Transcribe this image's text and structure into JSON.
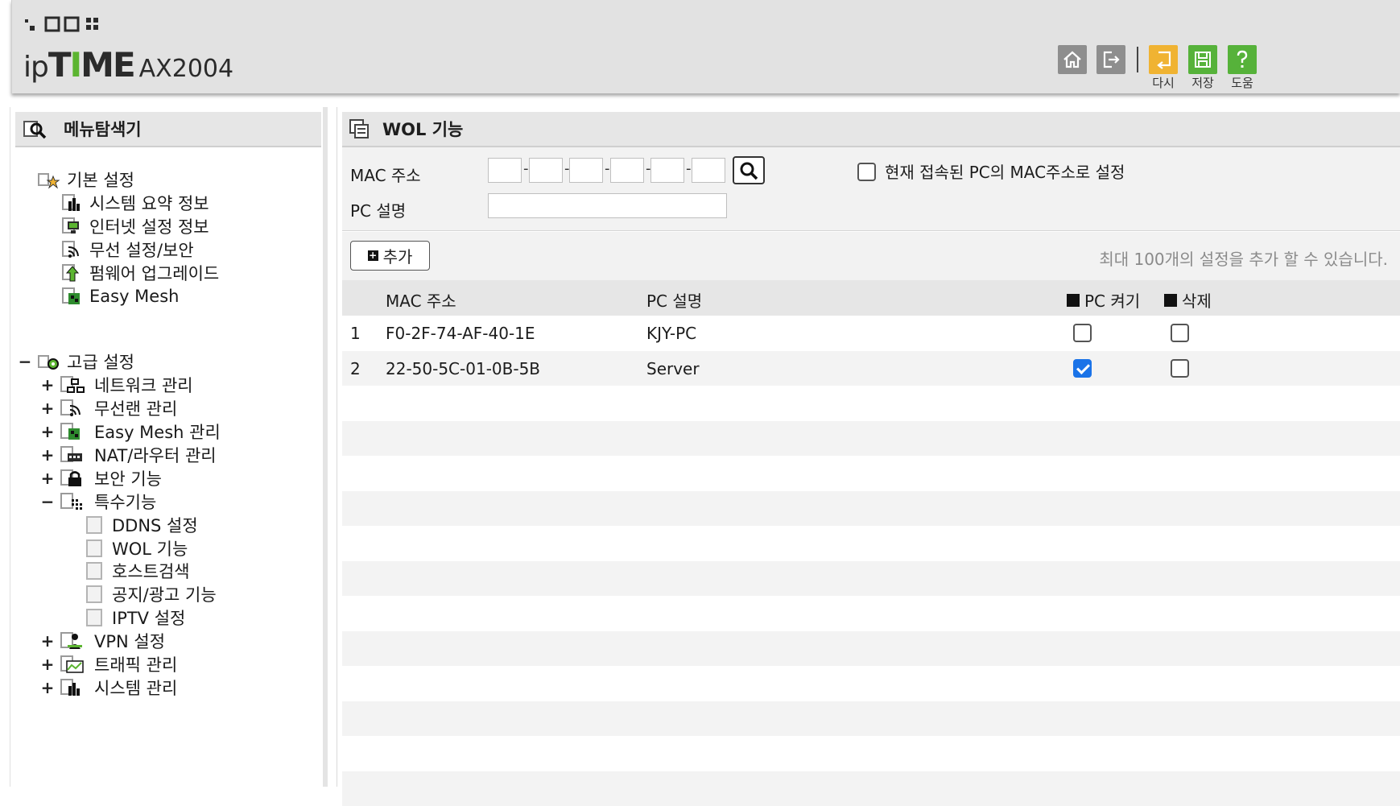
{
  "header": {
    "logo_ip": "ip",
    "logo_time_left": "T",
    "logo_time_i": "I",
    "logo_time_right": "ME",
    "model": "AX2004",
    "buttons": [
      {
        "name": "home",
        "label": ""
      },
      {
        "name": "logout",
        "label": ""
      },
      {
        "name": "redo",
        "label": "다시"
      },
      {
        "name": "save",
        "label": "저장"
      },
      {
        "name": "help",
        "label": "도움"
      }
    ],
    "colors": {
      "yellow": "#f0b332",
      "green": "#56b23a",
      "gray": "#8e8e8e",
      "logo_accent": "#5cb531"
    }
  },
  "sidebar": {
    "title": "메뉴탐색기",
    "basic": {
      "label": "기본 설정",
      "items": [
        "시스템 요약 정보",
        "인터넷 설정 정보",
        "무선 설정/보안",
        "펌웨어 업그레이드",
        "Easy Mesh"
      ]
    },
    "advanced": {
      "toggle": "−",
      "label": "고급 설정",
      "items": [
        {
          "toggle": "+",
          "label": "네트워크 관리"
        },
        {
          "toggle": "+",
          "label": "무선랜 관리"
        },
        {
          "toggle": "+",
          "label": "Easy Mesh 관리"
        },
        {
          "toggle": "+",
          "label": "NAT/라우터 관리"
        },
        {
          "toggle": "+",
          "label": "보안 기능"
        },
        {
          "toggle": "−",
          "label": "특수기능"
        },
        {
          "toggle": "+",
          "label": "VPN 설정"
        },
        {
          "toggle": "+",
          "label": "트래픽 관리"
        },
        {
          "toggle": "+",
          "label": "시스템 관리"
        }
      ],
      "special_children": [
        "DDNS 설정",
        "WOL 기능",
        "호스트검색",
        "공지/광고 기능",
        "IPTV 설정"
      ]
    }
  },
  "main": {
    "title": "WOL 기능",
    "form": {
      "mac_label": "MAC 주소",
      "mac_values": [
        "",
        "",
        "",
        "",
        "",
        ""
      ],
      "desc_label": "PC 설명",
      "desc_value": "",
      "use_current_label": "현재 접속된 PC의 MAC주소로 설정",
      "use_current_checked": false
    },
    "add_label": "추가",
    "note": "최대 100개의 설정을 추가 할 수 있습니다.",
    "table": {
      "headers": {
        "mac": "MAC 주소",
        "desc": "PC 설명",
        "wake": "PC 켜기",
        "delete": "삭제"
      },
      "rows": [
        {
          "no": "1",
          "mac": "F0-2F-74-AF-40-1E",
          "desc": "KJY-PC",
          "wake": false,
          "delete": false
        },
        {
          "no": "2",
          "mac": "22-50-5C-01-0B-5B",
          "desc": "Server",
          "wake": true,
          "delete": false
        }
      ]
    }
  }
}
